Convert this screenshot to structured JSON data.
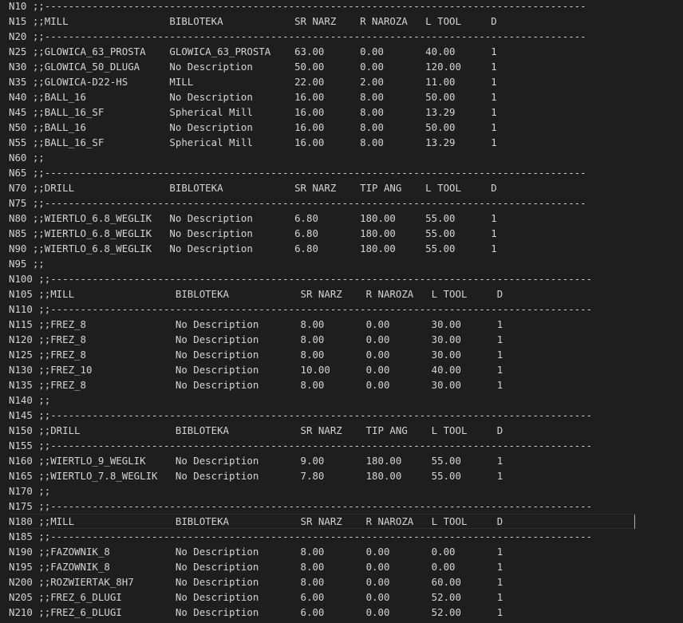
{
  "lines": [
    "N10 ;;-------------------------------------------------------------------------------------------",
    "N15 ;;MILL                 BIBLOTEKA            SR NARZ    R NAROZA   L TOOL     D",
    "N20 ;;-------------------------------------------------------------------------------------------",
    "N25 ;;GLOWICA_63_PROSTA    GLOWICA_63_PROSTA    63.00      0.00       40.00      1",
    "N30 ;;GLOWICA_50_DLUGA     No Description       50.00      0.00       120.00     1",
    "N35 ;;GLOWICA-D22-HS       MILL                 22.00      2.00       11.00      1",
    "N40 ;;BALL_16              No Description       16.00      8.00       50.00      1",
    "N45 ;;BALL_16_SF           Spherical Mill       16.00      8.00       13.29      1",
    "N50 ;;BALL_16              No Description       16.00      8.00       50.00      1",
    "N55 ;;BALL_16_SF           Spherical Mill       16.00      8.00       13.29      1",
    "N60 ;;",
    "N65 ;;-------------------------------------------------------------------------------------------",
    "N70 ;;DRILL                BIBLOTEKA            SR NARZ    TIP ANG    L TOOL     D",
    "N75 ;;-------------------------------------------------------------------------------------------",
    "N80 ;;WIERTLO_6.8_WEGLIK   No Description       6.80       180.00     55.00      1",
    "N85 ;;WIERTLO_6.8_WEGLIK   No Description       6.80       180.00     55.00      1",
    "N90 ;;WIERTLO_6.8_WEGLIK   No Description       6.80       180.00     55.00      1",
    "N95 ;;",
    "N100 ;;-------------------------------------------------------------------------------------------",
    "N105 ;;MILL                 BIBLOTEKA            SR NARZ    R NAROZA   L TOOL     D",
    "N110 ;;-------------------------------------------------------------------------------------------",
    "N115 ;;FREZ_8               No Description       8.00       0.00       30.00      1",
    "N120 ;;FREZ_8               No Description       8.00       0.00       30.00      1",
    "N125 ;;FREZ_8               No Description       8.00       0.00       30.00      1",
    "N130 ;;FREZ_10              No Description       10.00      0.00       40.00      1",
    "N135 ;;FREZ_8               No Description       8.00       0.00       30.00      1",
    "N140 ;;",
    "N145 ;;-------------------------------------------------------------------------------------------",
    "N150 ;;DRILL                BIBLOTEKA            SR NARZ    TIP ANG    L TOOL     D",
    "N155 ;;-------------------------------------------------------------------------------------------",
    "N160 ;;WIERTLO_9_WEGLIK     No Description       9.00       180.00     55.00      1",
    "N165 ;;WIERTLO_7.8_WEGLIK   No Description       7.80       180.00     55.00      1",
    "N170 ;;",
    "N175 ;;-------------------------------------------------------------------------------------------",
    "N180 ;;MILL                 BIBLOTEKA            SR NARZ    R NAROZA   L TOOL     D",
    "N185 ;;-------------------------------------------------------------------------------------------",
    "N190 ;;FAZOWNIK_8           No Description       8.00       0.00       0.00       1",
    "N195 ;;FAZOWNIK_8           No Description       8.00       0.00       0.00       1",
    "N200 ;;ROZWIERTAK_8H7       No Description       8.00       0.00       60.00      1",
    "N205 ;;FREZ_6_DLUGI         No Description       6.00       0.00       52.00      1",
    "N210 ;;FREZ_6_DLUGI         No Description       6.00       0.00       52.00      1"
  ],
  "theme": {
    "background": "#1e1e1e",
    "text": "#d4d4d4",
    "cursor": "#aeafad"
  }
}
